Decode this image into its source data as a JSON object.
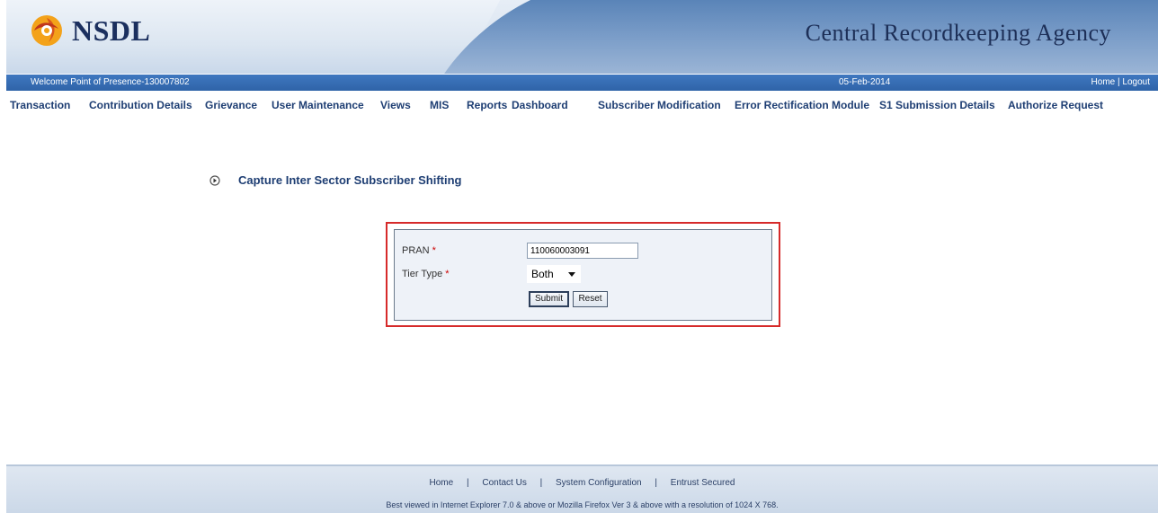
{
  "header": {
    "logo_text": "NSDL",
    "title": "Central Recordkeeping Agency"
  },
  "infobar": {
    "welcome": "Welcome Point of Presence-130007802",
    "date": "05-Feb-2014",
    "home_link": "Home",
    "separator": "|",
    "logout_link": "Logout"
  },
  "menu": {
    "items": [
      {
        "label": "Transaction"
      },
      {
        "label": "Contribution Details"
      },
      {
        "label": "Grievance"
      },
      {
        "label": "User Maintenance"
      },
      {
        "label": "Views"
      },
      {
        "label": "MIS"
      },
      {
        "label": "Reports"
      },
      {
        "label": "Dashboard"
      },
      {
        "label": "Subscriber Modification"
      },
      {
        "label": "Error Rectification Module"
      },
      {
        "label": "S1 Submission Details"
      },
      {
        "label": "Authorize Request"
      }
    ]
  },
  "page": {
    "title": "Capture Inter Sector Subscriber Shifting"
  },
  "form": {
    "pran_label": "PRAN",
    "required_mark": "*",
    "pran_value": "110060003091",
    "tier_label": "Tier Type",
    "tier_value": "Both",
    "submit_label": "Submit",
    "reset_label": "Reset"
  },
  "footer": {
    "links": [
      "Home",
      "Contact Us",
      "System Configuration",
      "Entrust Secured"
    ],
    "separator": "|",
    "note": "Best viewed in Internet Explorer 7.0 & above or Mozilla Firefox Ver 3 & above with a resolution of 1024 X 768."
  },
  "colors": {
    "brand_blue": "#2f63a8",
    "menu_text": "#1e3e73",
    "highlight_red": "#d62a2a"
  }
}
